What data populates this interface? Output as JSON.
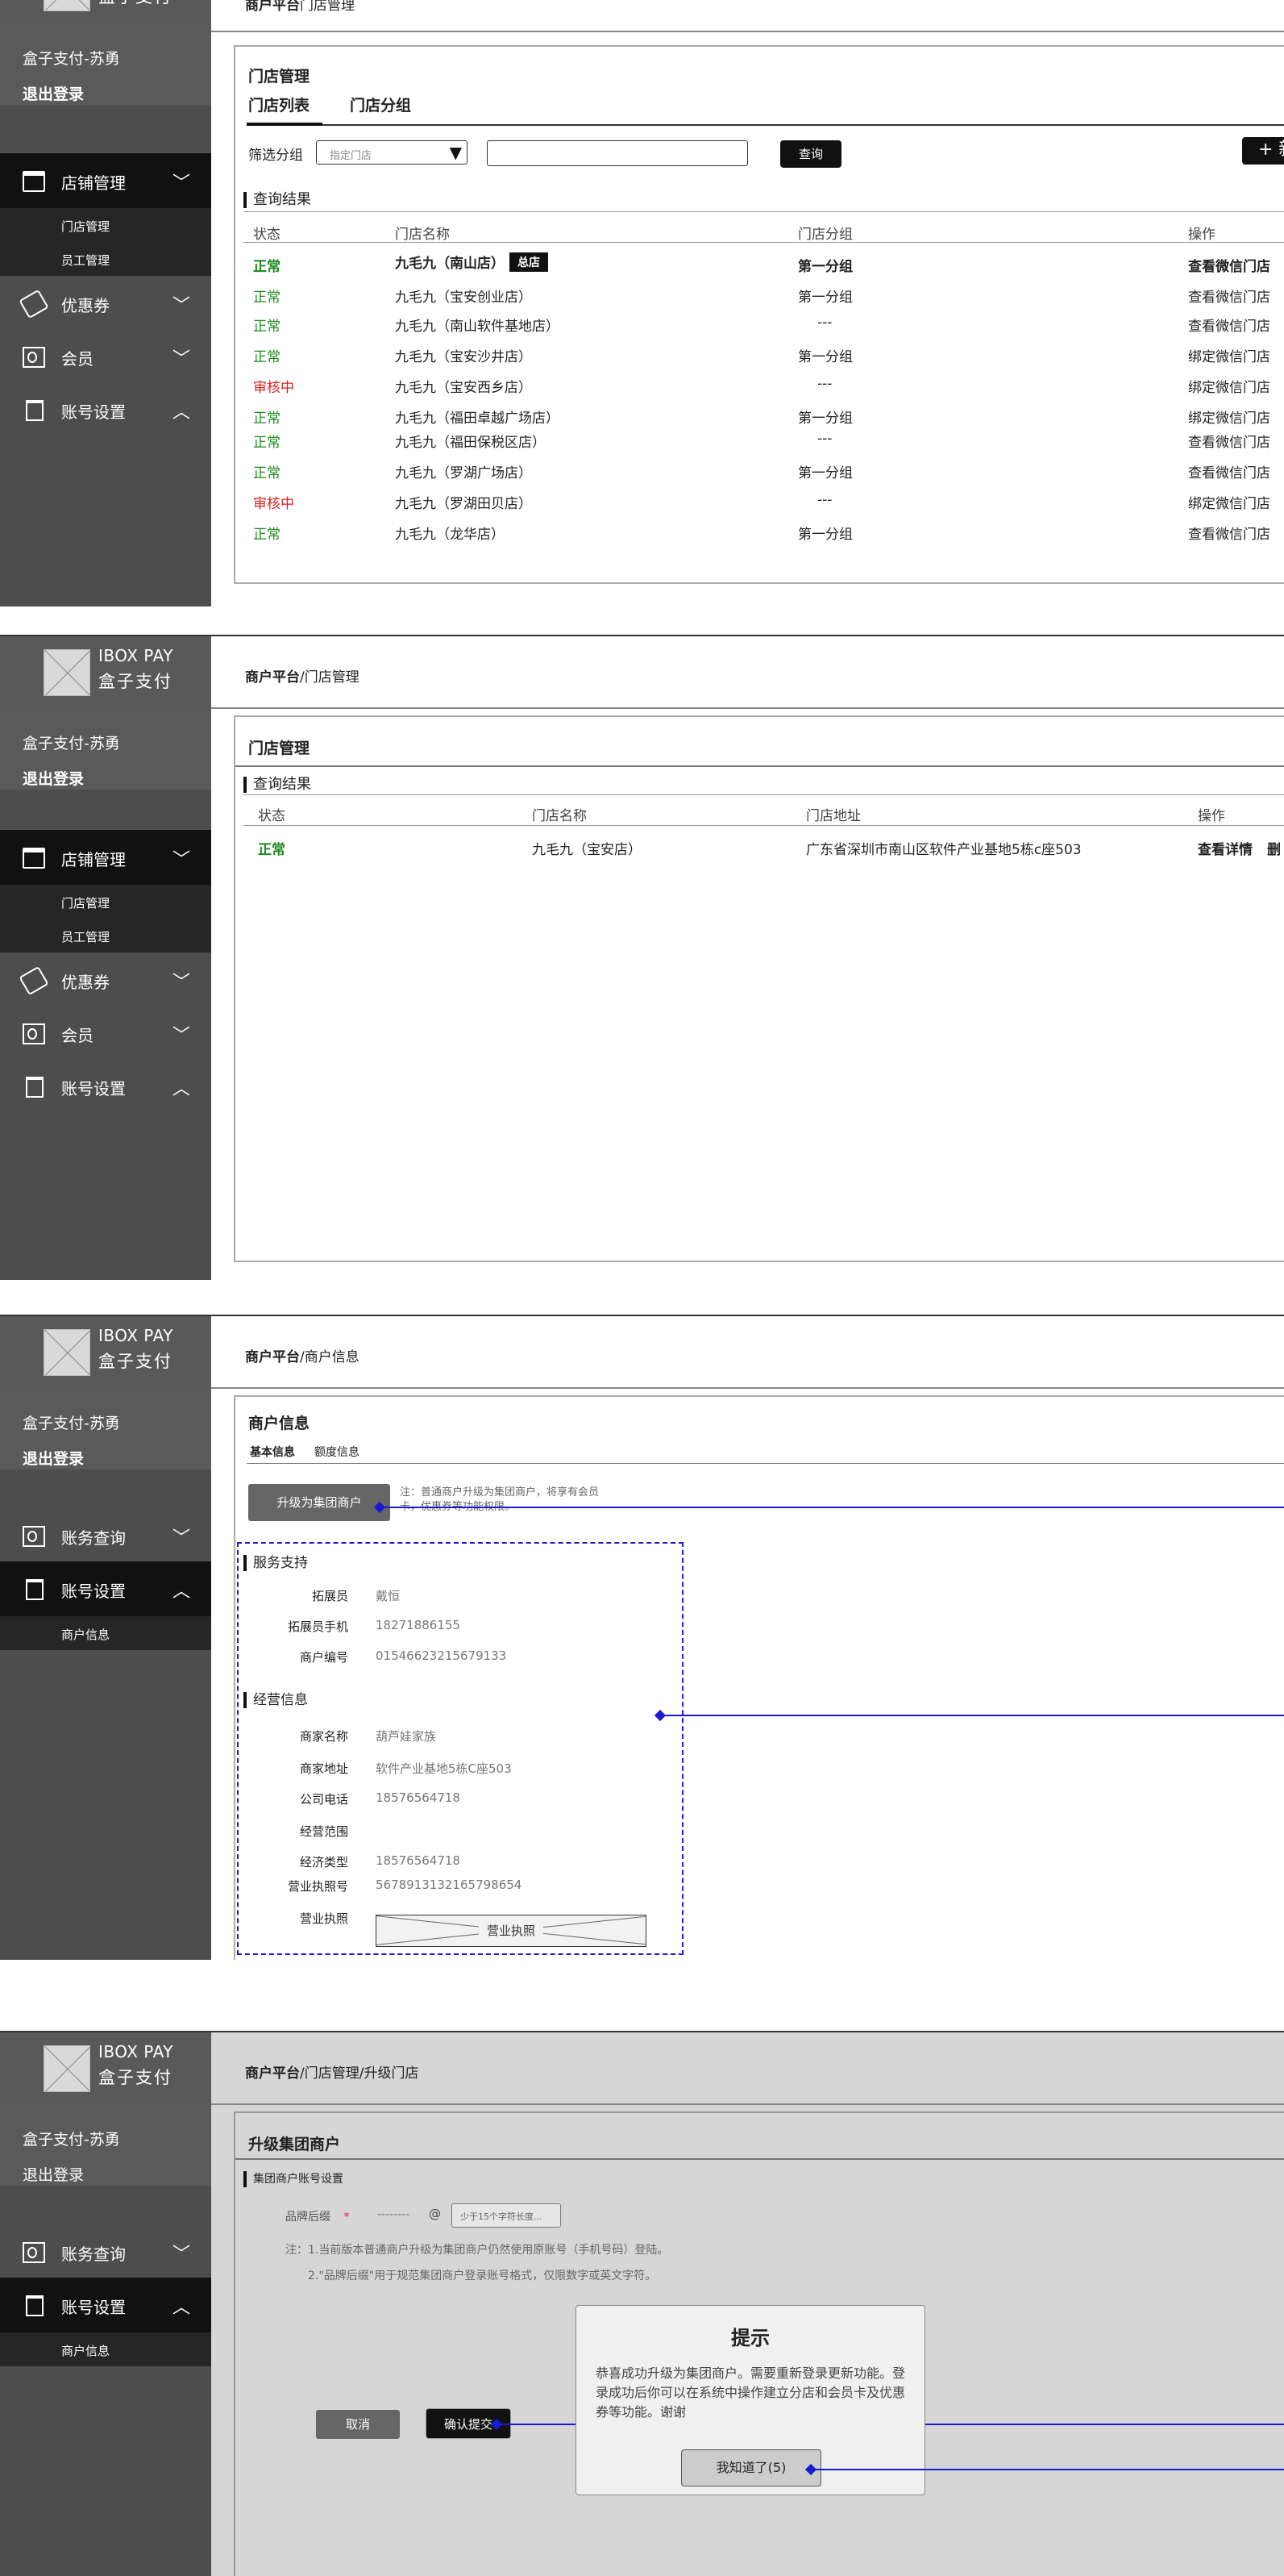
{
  "sidebar": {
    "logo_text": "IBOX PAY",
    "logo_subtitle": "盒子支付",
    "account_name": "盒子支付-苏勇",
    "logout": "退出登录",
    "menu": {
      "store": "店铺管理",
      "coupon": "优惠券",
      "member": "会员",
      "account_settings": "账号设置",
      "account_query": "账务查询"
    },
    "sub": {
      "store_mgmt": "门店管理",
      "staff_mgmt": "员工管理",
      "merchant_info": "商户信息"
    }
  },
  "panel1": {
    "breadcrumb_rest": "门店管理",
    "card_title": "门店管理",
    "tab_list": "门店列表",
    "tab_group": "门店分组",
    "filter_label": "筛选分组",
    "filter_placeholder": "指定门店",
    "query_btn": "查询",
    "add_btn": "+ 新",
    "results_label": "查询结果",
    "headers": {
      "status": "状态",
      "name": "门店名称",
      "group": "门店分组",
      "action": "操作"
    },
    "hq_badge": "总店",
    "rows": [
      {
        "status": "正常",
        "name": "九毛九（南山店）",
        "group": "第一分组",
        "action": "查看微信门店"
      },
      {
        "status": "正常",
        "name": "九毛九（宝安创业店）",
        "group": "第一分组",
        "action": "查看微信门店"
      },
      {
        "status": "正常",
        "name": "九毛九（南山软件基地店）",
        "group": "---",
        "action": "查看微信门店"
      },
      {
        "status": "正常",
        "name": "九毛九（宝安沙井店）",
        "group": "第一分组",
        "action": "绑定微信门店"
      },
      {
        "status": "审核中",
        "name": "九毛九（宝安西乡店）",
        "group": "---",
        "action": "绑定微信门店"
      },
      {
        "status": "正常",
        "name": "九毛九（福田卓越广场店）",
        "group": "第一分组",
        "action": "绑定微信门店"
      },
      {
        "status": "正常",
        "name": "九毛九（福田保税区店）",
        "group": "---",
        "action": "查看微信门店"
      },
      {
        "status": "正常",
        "name": "九毛九（罗湖广场店）",
        "group": "第一分组",
        "action": "查看微信门店"
      },
      {
        "status": "审核中",
        "name": "九毛九（罗湖田贝店）",
        "group": "---",
        "action": "绑定微信门店"
      },
      {
        "status": "正常",
        "name": "九毛九（龙华店）",
        "group": "第一分组",
        "action": "查看微信门店"
      }
    ]
  },
  "panel2": {
    "breadcrumb_root": "商户平台",
    "breadcrumb_rest": "/门店管理",
    "card_title": "门店管理",
    "results_label": "查询结果",
    "headers": {
      "status": "状态",
      "name": "门店名称",
      "address": "门店地址",
      "action": "操作"
    },
    "row": {
      "status": "正常",
      "name": "九毛九（宝安店）",
      "address": "广东省深圳市南山区软件产业基地5栋c座503",
      "action_detail": "查看详情",
      "action_delete": "删"
    }
  },
  "panel3": {
    "breadcrumb_root": "商户平台",
    "breadcrumb_rest": "/商户信息",
    "card_title": "商户信息",
    "tab_basic": "基本信息",
    "tab_quota": "额度信息",
    "upgrade_btn": "升级为集团商户",
    "upgrade_note": "注：普通商户升级为集团商户，将享有会员卡，优惠券等功能权限。",
    "service_title": "服务支持",
    "service_fields": [
      {
        "label": "拓展员",
        "value": "戴恒"
      },
      {
        "label": "拓展员手机",
        "value": "18271886155"
      },
      {
        "label": "商户编号",
        "value": "01546623215679133"
      }
    ],
    "biz_title": "经营信息",
    "biz_fields": [
      {
        "label": "商家名称",
        "value": "葫芦娃家族"
      },
      {
        "label": "商家地址",
        "value": "软件产业基地5栋C座503"
      },
      {
        "label": "公司电话",
        "value": "18576564718"
      },
      {
        "label": "经营范围",
        "value": ""
      },
      {
        "label": "经济类型",
        "value": "18576564718"
      },
      {
        "label": "营业执照号",
        "value": "5678913132165798654"
      },
      {
        "label": "营业执照",
        "value": ""
      }
    ],
    "license_placeholder": "营业执照"
  },
  "panel4": {
    "breadcrumb_root": "商户平台",
    "breadcrumb_rest": "/门店管理/升级门店",
    "card_title": "升级集团商户",
    "section_title": "集团商户账号设置",
    "brand_label": "品牌后缀",
    "brand_required": "*",
    "brand_value": "--------",
    "brand_at": "@",
    "brand_placeholder": "少于15个字符长度...",
    "note1": "注：1.当前版本普通商户升级为集团商户仍然使用原账号（手机号码）登陆。",
    "note2": "2.\"品牌后缀\"用于规范集团商户登录账号格式，仅限数字或英文字符。",
    "cancel_btn": "取消",
    "confirm_btn": "确认提交",
    "dialog_title": "提示",
    "dialog_body": "恭喜成功升级为集团商户。需要重新登录更新功能。登录成功后你可以在系统中操作建立分店和会员卡及优惠券等功能。谢谢",
    "dialog_btn": "我知道了(5)"
  },
  "colors": {
    "sidebar_bg": "#4d4d4d",
    "active_bg": "#111111",
    "status_ok": "#1d8a1d",
    "status_pending": "#e02020",
    "annotation": "#1a1ad1"
  },
  "icons": [
    "shop-icon",
    "coupon-icon",
    "member-card-icon",
    "clipboard-icon",
    "chevron-down-icon",
    "chevron-up-icon",
    "logo-placeholder-icon"
  ]
}
